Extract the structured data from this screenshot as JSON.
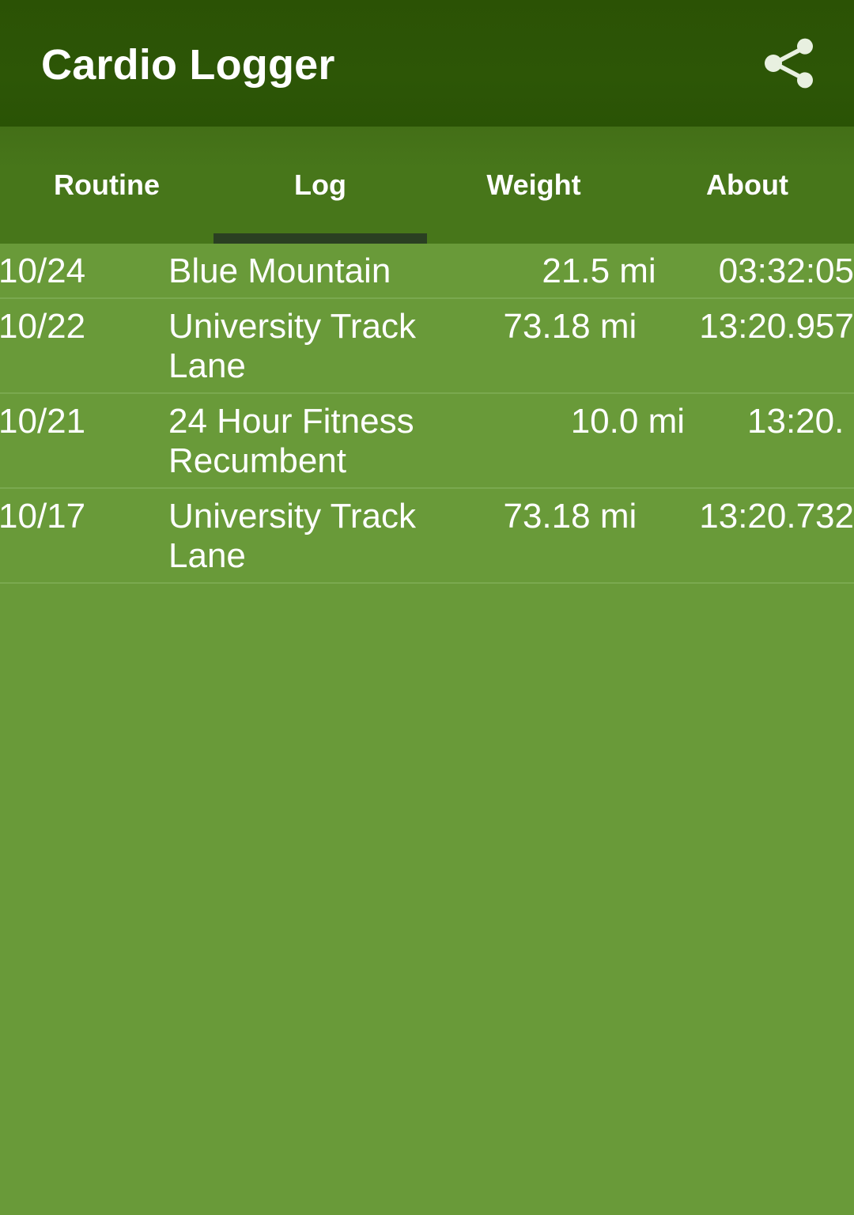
{
  "app": {
    "title": "Cardio Logger",
    "header_bg": "#2a5305",
    "tabbar_bg": "#47761a",
    "list_bg": "#699a39",
    "indicator_color": "#2a3f22",
    "text_color": "#ffffff"
  },
  "actions": {
    "share_icon": "share-icon"
  },
  "tabs": [
    {
      "label": "Routine",
      "selected": false
    },
    {
      "label": "Log",
      "selected": true
    },
    {
      "label": "Weight",
      "selected": false
    },
    {
      "label": "About",
      "selected": false
    }
  ],
  "log": {
    "columns": [
      "date",
      "name",
      "distance",
      "time"
    ],
    "rows": [
      {
        "date": "10/24",
        "name": "Blue Mountain",
        "distance": "21.5 mi",
        "time": "03:32:05"
      },
      {
        "date": "10/22",
        "name": "University Track Lane",
        "distance": "73.18 mi",
        "time": "13:20.957"
      },
      {
        "date": "10/21",
        "name": "24 Hour Fitness Recumbent",
        "distance": "10.0 mi",
        "time": "13:20."
      },
      {
        "date": "10/17",
        "name": "University Track Lane",
        "distance": "73.18 mi",
        "time": "13:20.732"
      }
    ]
  }
}
